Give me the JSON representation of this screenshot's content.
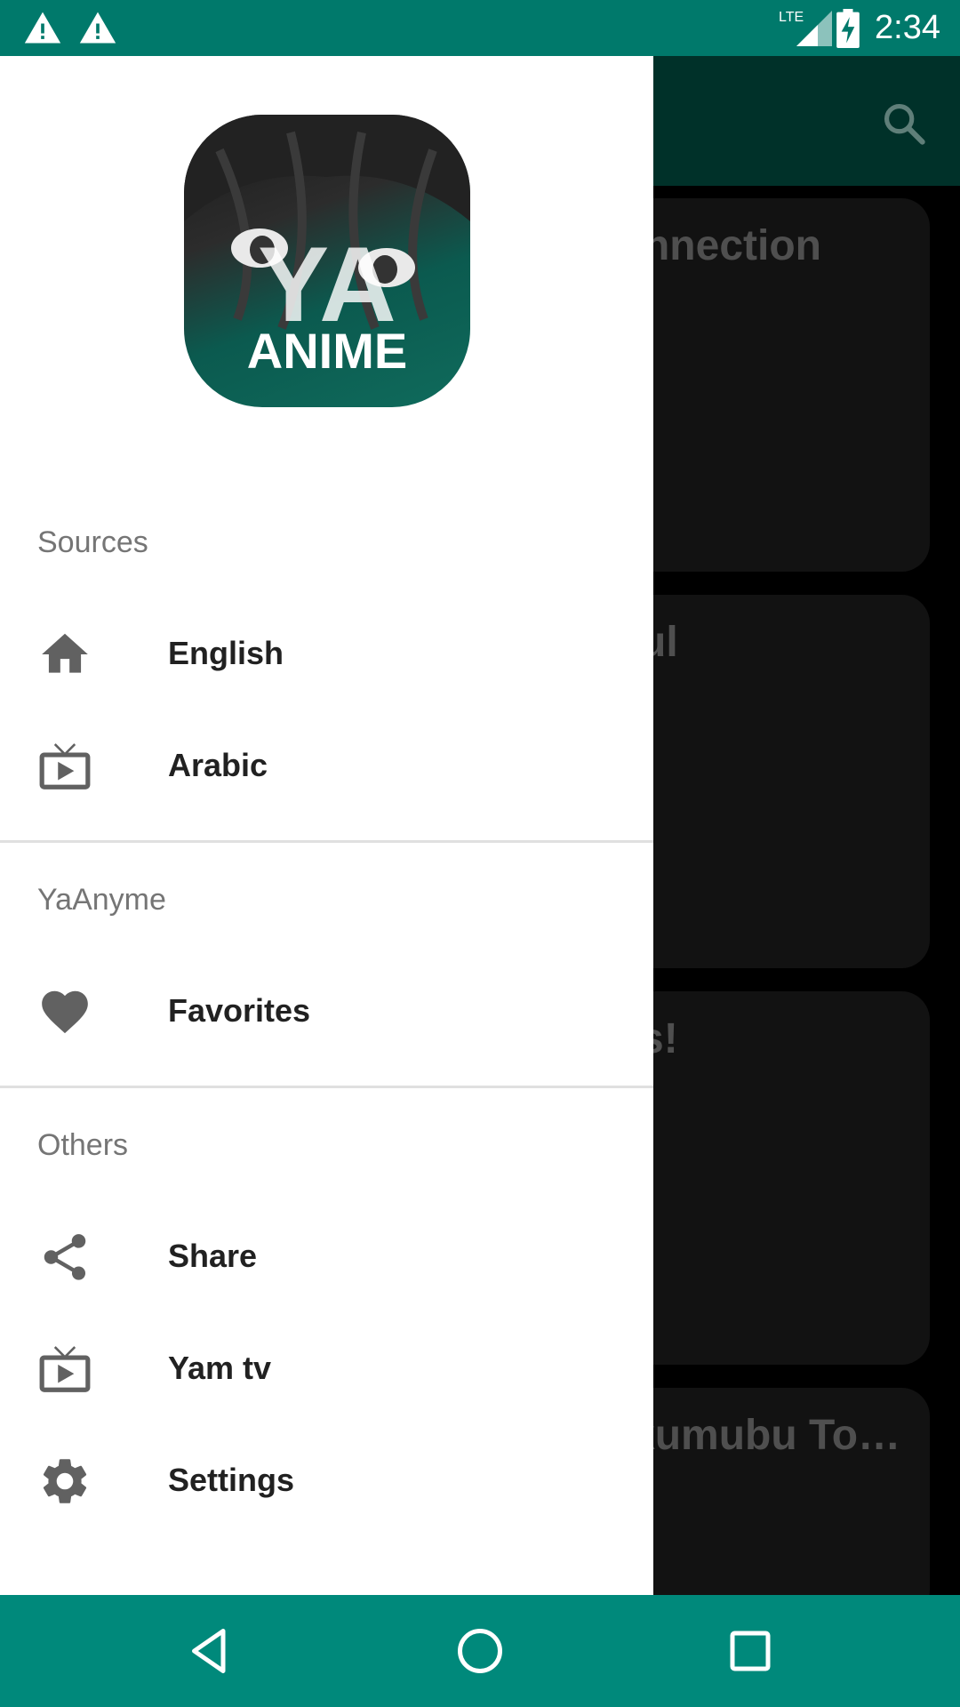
{
  "status_bar": {
    "time": "2:34",
    "network": "LTE",
    "icons": [
      "warning-icon",
      "warning-icon",
      "lte-signal-icon",
      "battery-charging-icon"
    ]
  },
  "colors": {
    "primary": "#00796b",
    "nav_bar": "#00897b",
    "drawer_bg": "#ffffff",
    "section_label": "#757575",
    "item_label": "#212121",
    "icon": "#616161",
    "dim_card": "#121212"
  },
  "background": {
    "toolbar_icon": "search-icon",
    "cards": [
      {
        "title": "Connection"
      },
      {
        "title": "ul"
      },
      {
        "title": "s!"
      },
      {
        "title": "kumubu To…"
      }
    ]
  },
  "drawer": {
    "logo": {
      "line1": "YA",
      "line2": "ANIME"
    },
    "sections": [
      {
        "label": "Sources",
        "items": [
          {
            "label": "English",
            "icon": "home-icon"
          },
          {
            "label": "Arabic",
            "icon": "tv-icon"
          }
        ]
      },
      {
        "label": "YaAnyme",
        "items": [
          {
            "label": "Favorites",
            "icon": "heart-icon"
          }
        ]
      },
      {
        "label": "Others",
        "items": [
          {
            "label": "Share",
            "icon": "share-icon"
          },
          {
            "label": "Yam tv",
            "icon": "tv-icon"
          },
          {
            "label": "Settings",
            "icon": "gear-icon"
          }
        ]
      }
    ]
  },
  "nav_bar": {
    "buttons": [
      "back-icon",
      "home-circle-icon",
      "recents-icon"
    ]
  }
}
